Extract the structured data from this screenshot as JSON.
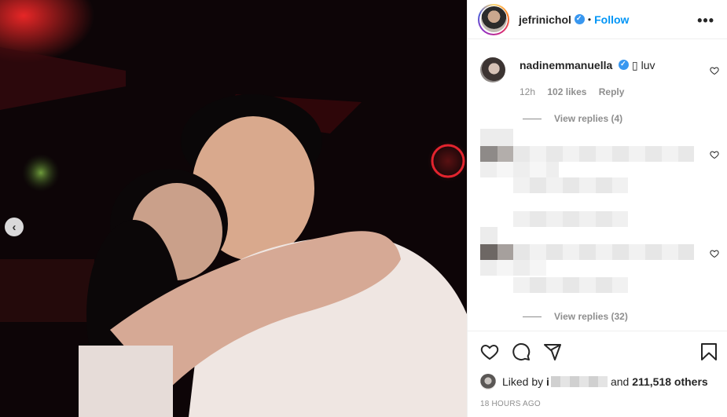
{
  "post": {
    "username": "jefrinichol",
    "follow_label": "Follow",
    "more_label": "•••",
    "prev_label": "‹"
  },
  "comments": [
    {
      "username": "nadinemmanuella",
      "text": "luv",
      "emoji": "▯",
      "time": "12h",
      "likes": "102 likes",
      "reply_label": "Reply",
      "view_replies": "View replies (4)"
    }
  ],
  "second_thread": {
    "view_replies": "View replies (32)"
  },
  "likes": {
    "prefix": "Liked by",
    "masked_start": "i",
    "suffix": "and",
    "count": "211,518 others"
  },
  "timestamp": "18 HOURS AGO",
  "icons": {
    "like": "heart-icon",
    "comment": "comment-icon",
    "share": "share-icon",
    "save": "bookmark-icon",
    "verified": "verified-badge-icon"
  },
  "colors": {
    "accent": "#0095f6",
    "muted": "#8e8e8e",
    "verified": "#3897f0"
  }
}
